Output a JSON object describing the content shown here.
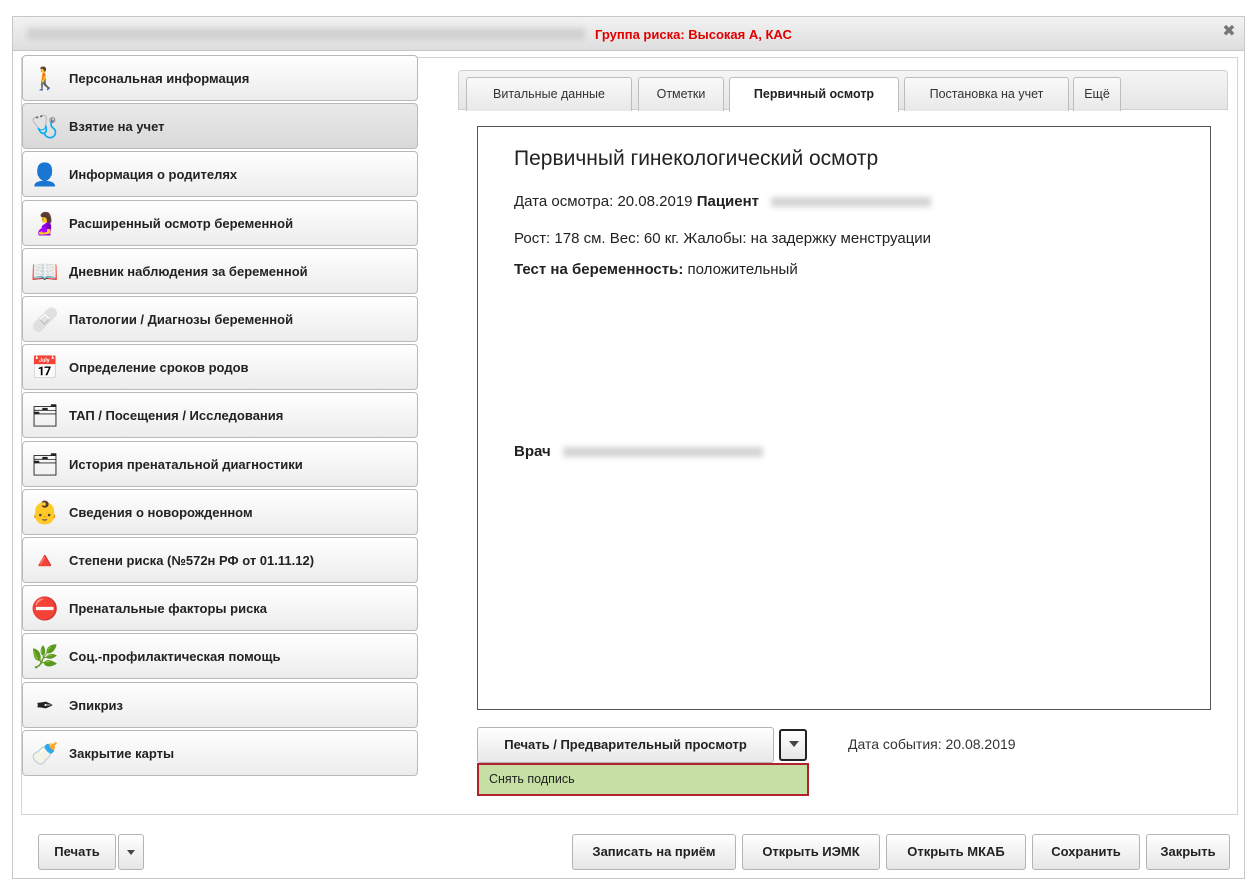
{
  "window": {
    "risk_group": "Группа риска: Высокая А, КАС",
    "close_glyph": "✖"
  },
  "sidebar": {
    "items": [
      {
        "label": "Персональная информация",
        "icon": "person-icon",
        "glyph": "🚶"
      },
      {
        "label": "Взятие на учет",
        "icon": "registration-icon",
        "glyph": "🩺"
      },
      {
        "label": "Информация о родителях",
        "icon": "parents-icon",
        "glyph": "👤"
      },
      {
        "label": "Расширенный осмотр беременной",
        "icon": "pregnant-exam-icon",
        "glyph": "🤰"
      },
      {
        "label": "Дневник наблюдения за беременной",
        "icon": "diary-icon",
        "glyph": "📖"
      },
      {
        "label": "Патологии / Диагнозы беременной",
        "icon": "first-aid-icon",
        "glyph": "🩹"
      },
      {
        "label": "Определение сроков родов",
        "icon": "calendar-icon",
        "glyph": "📅"
      },
      {
        "label": "ТАП / Посещения / Исследования",
        "icon": "card-index-icon",
        "glyph": "🗂"
      },
      {
        "label": "История пренатальной диагностики",
        "icon": "card-index-icon",
        "glyph": "🗂"
      },
      {
        "label": "Сведения о новорожденном",
        "icon": "newborn-icon",
        "glyph": "👶"
      },
      {
        "label": "Степени риска (№572н РФ от 01.11.12)",
        "icon": "risk-shapes-icon",
        "glyph": "🔺"
      },
      {
        "label": "Пренатальные факторы риска",
        "icon": "prenatal-risk-icon",
        "glyph": "⛔"
      },
      {
        "label": "Соц.-профилактическая помощь",
        "icon": "social-help-icon",
        "glyph": "🌿"
      },
      {
        "label": "Эпикриз",
        "icon": "pen-icon",
        "glyph": "✒"
      },
      {
        "label": "Закрытие карты",
        "icon": "baby-face-icon",
        "glyph": "🍼"
      }
    ],
    "active_index": 1
  },
  "tabs": [
    {
      "label": "Витальные данные"
    },
    {
      "label": "Отметки"
    },
    {
      "label": "Первичный осмотр"
    },
    {
      "label": "Постановка на учет"
    },
    {
      "label": "Ещё"
    }
  ],
  "document": {
    "title": "Первичный гинекологический осмотр",
    "date_label": "Дата осмотра:",
    "date_value": "20.08.2019",
    "patient_label": "Пациент",
    "height_text": "Рост: 178 см.",
    "weight_text": "Вес: 60 кг.",
    "complaints_text": "Жалобы: на задержку менструации",
    "test_label": "Тест на беременность:",
    "test_value": "положительный",
    "doctor_label": "Врач"
  },
  "print_group": {
    "button_label": "Печать / Предварительный просмотр",
    "event_date": "Дата события: 20.08.2019",
    "dropdown_item": "Снять подпись"
  },
  "bottom_bar": {
    "print": "Печать",
    "appointment": "Записать на приём",
    "open_iemk": "Открыть ИЭМК",
    "open_mkab": "Открыть МКАБ",
    "save": "Сохранить",
    "close": "Закрыть"
  }
}
